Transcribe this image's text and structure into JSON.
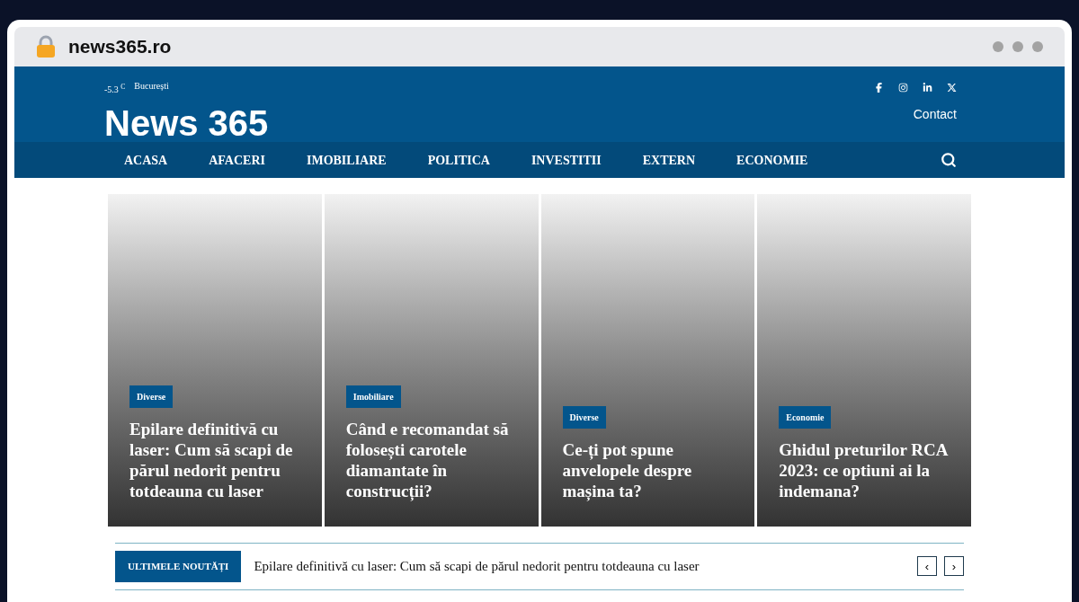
{
  "browser": {
    "url": "news365.ro"
  },
  "header": {
    "temperature": "-5.3",
    "unit": "C",
    "city": "București",
    "logo": "News 365",
    "contact": "Contact"
  },
  "nav": [
    {
      "label": "ACASA"
    },
    {
      "label": "AFACERI"
    },
    {
      "label": "IMOBILIARE"
    },
    {
      "label": "POLITICA"
    },
    {
      "label": "INVESTITII"
    },
    {
      "label": "EXTERN"
    },
    {
      "label": "ECONOMIE"
    }
  ],
  "articles": [
    {
      "category": "Diverse",
      "title": "Epilare definitivă cu laser: Cum să scapi de părul nedorit pentru totdeauna cu laser"
    },
    {
      "category": "Imobiliare",
      "title": "Când e recomandat să folosești carotele diamantate în construcții?"
    },
    {
      "category": "Diverse",
      "title": "Ce-ți pot spune anvelopele despre mașina ta?"
    },
    {
      "category": "Economie",
      "title": "Ghidul preturilor RCA 2023: ce optiuni ai la indemana?"
    }
  ],
  "ticker": {
    "label": "ULTIMELE NOUTĂȚI",
    "headline": "Epilare definitivă cu laser: Cum să scapi de părul nedorit pentru totdeauna cu laser",
    "prev": "‹",
    "next": "›"
  }
}
